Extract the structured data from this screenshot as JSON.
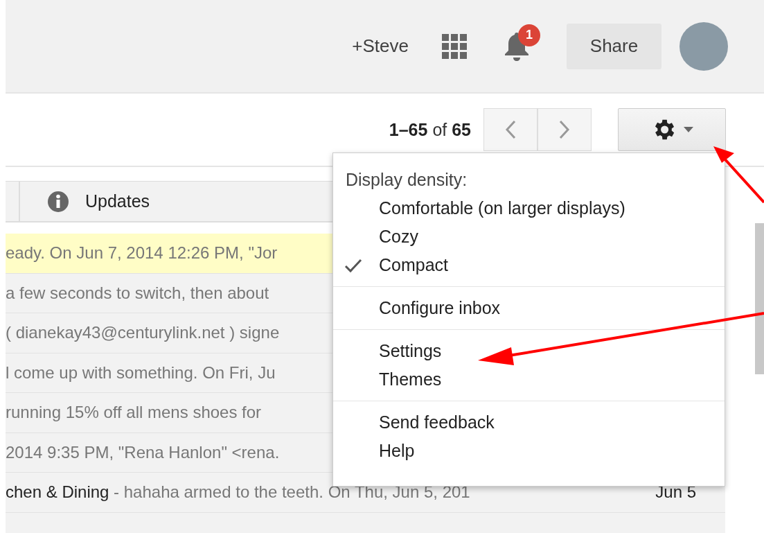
{
  "header": {
    "user": "+Steve",
    "notifications": "1",
    "share": "Share"
  },
  "toolbar": {
    "range": "**1–65** of **65**"
  },
  "tabs": [
    {
      "label": "Updates",
      "selected": false
    }
  ],
  "rows": [
    {
      "snippet": "eady. On Jun 7, 2014 12:26 PM, \"Jor",
      "highlighted": true
    },
    {
      "snippet": "a few seconds to switch, then about",
      "highlighted": false
    },
    {
      "snippet": "( dianekay43@centurylink.net ) signe",
      "highlighted": false
    },
    {
      "snippet": "l come up with something. On Fri, Ju",
      "highlighted": false
    },
    {
      "snippet": "running 15% off all mens shoes for",
      "highlighted": false
    },
    {
      "snippet": "2014 9:35 PM, \"Rena Hanlon\" <rena.",
      "highlighted": false
    },
    {
      "sender": "chen & Dining",
      "snippet": " - hahaha armed to the teeth. On Thu, Jun 5, 201",
      "date": "Jun 5",
      "highlighted": false
    },
    {
      "highlighted": false
    }
  ],
  "menu": {
    "sections": [
      {
        "heading": "Display density:",
        "items": [
          {
            "label": "Comfortable (on larger displays)",
            "checked": false
          },
          {
            "label": "Cozy",
            "checked": false
          },
          {
            "label": "Compact",
            "checked": true
          }
        ]
      },
      {
        "items": [
          {
            "label": "Configure inbox"
          }
        ]
      },
      {
        "items": [
          {
            "label": "Settings"
          },
          {
            "label": "Themes"
          }
        ]
      },
      {
        "items": [
          {
            "label": "Send feedback"
          },
          {
            "label": "Help"
          }
        ]
      }
    ]
  }
}
